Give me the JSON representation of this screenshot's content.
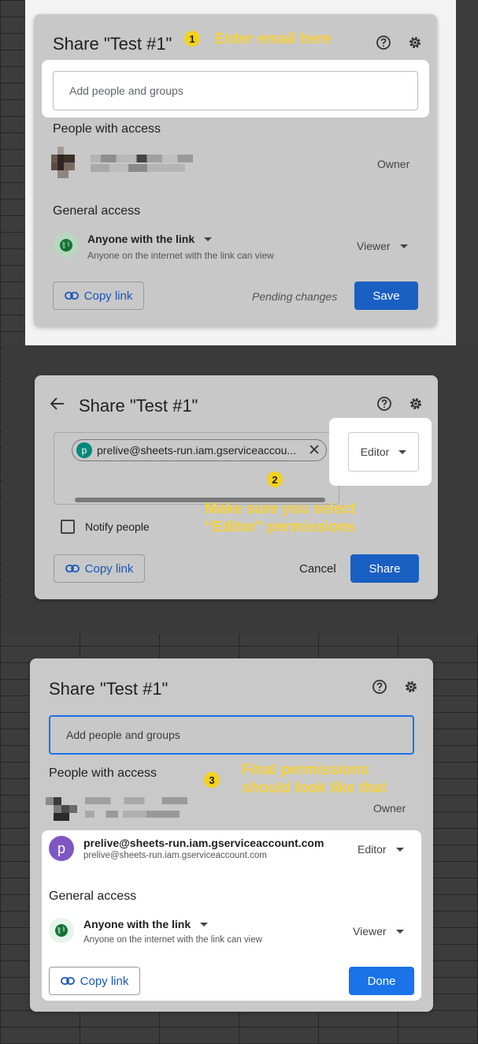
{
  "panel1": {
    "title": "Share \"Test #1\"",
    "step": "1",
    "annotation": "Enter email here",
    "search_placeholder": "Add people and groups",
    "people_heading": "People with access",
    "owner_role": "Owner",
    "general_heading": "General access",
    "access_scope": "Anyone with the link",
    "access_desc": "Anyone on the internet with the link can view",
    "access_role": "Viewer",
    "copy_link": "Copy link",
    "pending": "Pending changes",
    "save": "Save"
  },
  "panel2": {
    "title": "Share \"Test #1\"",
    "chip_initial": "p",
    "chip_email": "prelive@sheets-run.iam.gserviceaccou...",
    "role": "Editor",
    "step": "2",
    "annotation_line1": "Make sure you select",
    "annotation_line2": "“Editor” permissions",
    "notify": "Notify people",
    "copy_link": "Copy link",
    "cancel": "Cancel",
    "share": "Share"
  },
  "panel3": {
    "title": "Share \"Test #1\"",
    "search_placeholder": "Add people and groups",
    "people_heading": "People with access",
    "step": "3",
    "annotation_line1": "Final permissions",
    "annotation_line2": "should look like that",
    "owner_role": "Owner",
    "user_initial": "p",
    "user_name": "prelive@sheets-run.iam.gserviceaccount.com",
    "user_email": "prelive@sheets-run.iam.gserviceaccount.com",
    "user_role": "Editor",
    "general_heading": "General access",
    "access_scope": "Anyone with the link",
    "access_desc": "Anyone on the internet with the link can view",
    "access_role": "Viewer",
    "copy_link": "Copy link",
    "done": "Done"
  },
  "colors": {
    "accent_blue": "#1a73e8",
    "annotation_yellow": "#f6d23a",
    "avatar_purple": "#7e57c2",
    "chip_teal": "#00897b"
  },
  "icons": [
    "help-icon",
    "gear-icon",
    "back-arrow-icon",
    "link-icon",
    "globe-icon",
    "close-icon",
    "caret-down-icon"
  ]
}
